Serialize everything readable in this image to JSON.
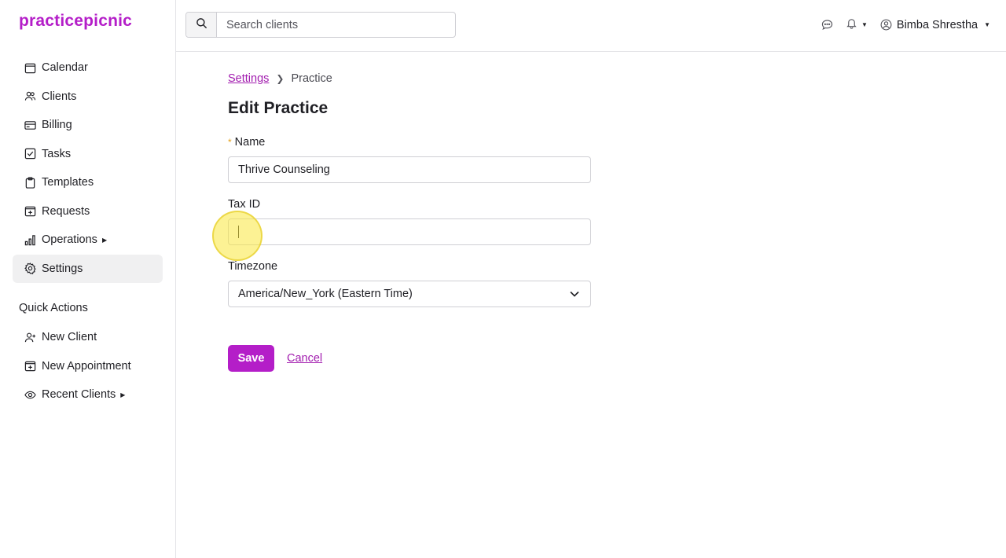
{
  "app": {
    "logo": "practicepicnic",
    "brand_color": "#b41ec8"
  },
  "sidebar": {
    "items": [
      {
        "label": "Calendar",
        "icon": "calendar-icon"
      },
      {
        "label": "Clients",
        "icon": "users-icon"
      },
      {
        "label": "Billing",
        "icon": "credit-card-icon"
      },
      {
        "label": "Tasks",
        "icon": "checkbox-icon"
      },
      {
        "label": "Templates",
        "icon": "clipboard-icon"
      },
      {
        "label": "Requests",
        "icon": "plus-square-icon"
      },
      {
        "label": "Operations",
        "icon": "bar-chart-icon"
      },
      {
        "label": "Settings",
        "icon": "gear-icon",
        "active": true
      }
    ],
    "quick_actions_title": "Quick Actions",
    "quick_actions": [
      {
        "label": "New Client",
        "icon": "add-user-icon"
      },
      {
        "label": "New Appointment",
        "icon": "plus-square-icon"
      },
      {
        "label": "Recent Clients",
        "icon": "eye-icon"
      }
    ]
  },
  "topbar": {
    "search_placeholder": "Search clients",
    "user_name": "Bimba Shrestha"
  },
  "breadcrumb": {
    "parent": "Settings",
    "current": "Practice"
  },
  "page": {
    "title": "Edit Practice"
  },
  "form": {
    "name_label": "Name",
    "name_value": "Thrive Counseling",
    "taxid_label": "Tax ID",
    "taxid_value": "",
    "timezone_label": "Timezone",
    "timezone_value": "America/New_York (Eastern Time)",
    "save_label": "Save",
    "cancel_label": "Cancel"
  }
}
